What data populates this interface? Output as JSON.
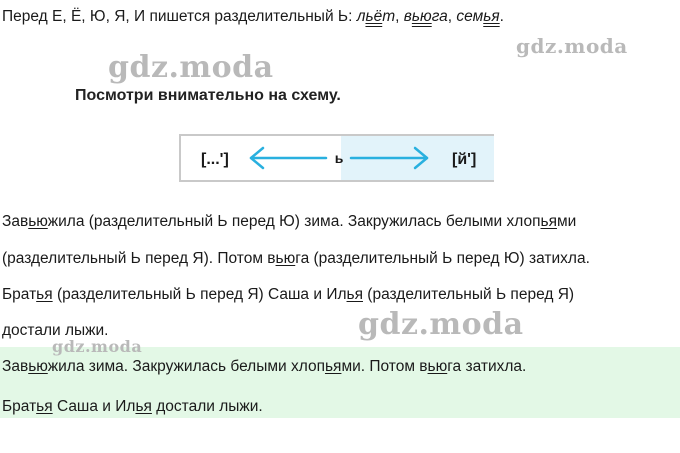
{
  "rule": {
    "prefix": "Перед Е, Ё, Ю, Я, И пишется разделительный Ь: ",
    "w1a": "л",
    "w1b": "ьё",
    "w1c": "т",
    "sep1": ", ",
    "w2a": "в",
    "w2b": "ью",
    "w2c": "га",
    "sep2": ", ",
    "w3a": "сем",
    "w3b": "ья",
    "end": "."
  },
  "watermark": "gdz.moda",
  "instruction": "Посмотри внимательно на схему.",
  "scheme": {
    "left": "[...']",
    "middle": "ь",
    "right": "[й']",
    "accent_color": "#29b0df",
    "fill_color": "#e2f3fa"
  },
  "explanation": {
    "l1a": "Зав",
    "l1b": "ью",
    "l1c": "жила (разделительный Ь перед Ю) зима. Закружилась белыми хлоп",
    "l1d": "ья",
    "l1e": "ми",
    "l2a": "(разделительный Ь перед Я). Потом в",
    "l2b": "ью",
    "l2c": "га (разделительный Ь перед Ю) затихла.",
    "l3a": "Брат",
    "l3b": "ья",
    "l3c": " (разделительный Ь перед Я) Саша и Ил",
    "l3d": "ья",
    "l3e": " (разделительный Ь перед Я)",
    "l4": "достали лыжи."
  },
  "answer": {
    "background": "#e3f8e6",
    "l1a": "Зав",
    "l1b": "ью",
    "l1c": "жила зима. Закружилась белыми хлоп",
    "l1d": "ья",
    "l1e": "ми. Потом в",
    "l1f": "ью",
    "l1g": "га затихла.",
    "l2a": "Брат",
    "l2b": "ья",
    "l2c": " Саша и Ил",
    "l2d": "ья",
    "l2e": " достали лыжи."
  }
}
